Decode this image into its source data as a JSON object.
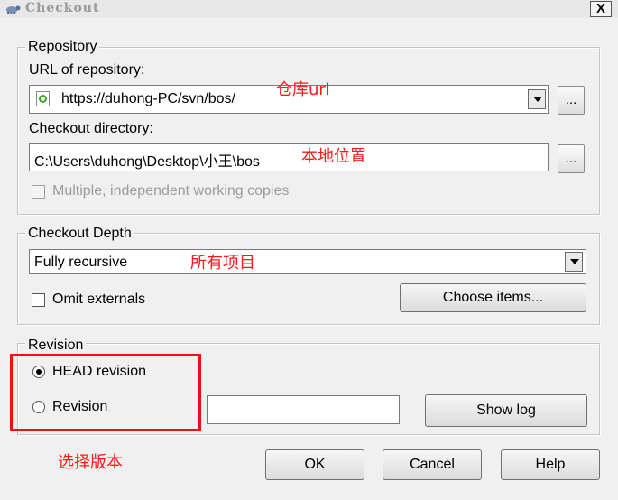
{
  "window": {
    "title": "Checkout",
    "close_glyph": "X",
    "icon": "turtle-svn-icon"
  },
  "repository": {
    "group_label": "Repository",
    "url_label": "URL of repository:",
    "url_value": "https://duhong-PC/svn/bos/",
    "url_browse": "...",
    "dir_label": "Checkout directory:",
    "dir_value": "C:\\Users\\duhong\\Desktop\\小王\\bos",
    "dir_browse": "...",
    "multiple_label": "Multiple, independent working copies"
  },
  "depth": {
    "group_label": "Checkout Depth",
    "value": "Fully recursive",
    "omit_label": "Omit externals",
    "choose_label": "Choose items..."
  },
  "revision": {
    "group_label": "Revision",
    "head_label": "HEAD revision",
    "rev_label": "Revision",
    "rev_value": "",
    "show_log_label": "Show log"
  },
  "buttons": {
    "ok": "OK",
    "cancel": "Cancel",
    "help": "Help"
  },
  "annotations": {
    "url": "仓库url",
    "dir": "本地位置",
    "depth": "所有项目",
    "revision": "选择版本",
    "highlight_color": "#ee1111"
  }
}
